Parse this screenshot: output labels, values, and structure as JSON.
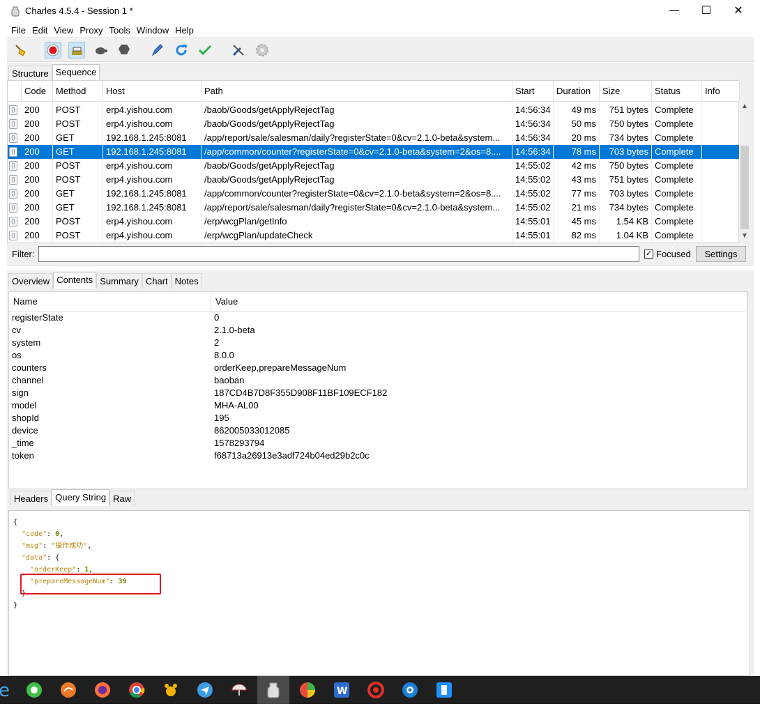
{
  "window": {
    "title": "Charles 4.5.4 - Session 1 *"
  },
  "menu": [
    "File",
    "Edit",
    "View",
    "Proxy",
    "Tools",
    "Window",
    "Help"
  ],
  "toolbar": [
    "broom-icon",
    "record-icon",
    "throttle-icon",
    "turtle-icon",
    "stop-icon",
    "pen-icon",
    "refresh-icon",
    "check-icon",
    "tools-icon",
    "gear-icon"
  ],
  "upper_tabs": [
    "Structure",
    "Sequence"
  ],
  "columns": [
    "Code",
    "Method",
    "Host",
    "Path",
    "Start",
    "Duration",
    "Size",
    "Status",
    "Info"
  ],
  "rows": [
    {
      "code": "200",
      "method": "POST",
      "host": "erp4.yishou.com",
      "path": "/baob/Goods/getApplyRejectTag",
      "start": "14:56:34",
      "duration": "49 ms",
      "size": "751 bytes",
      "status": "Complete",
      "selected": false
    },
    {
      "code": "200",
      "method": "POST",
      "host": "erp4.yishou.com",
      "path": "/baob/Goods/getApplyRejectTag",
      "start": "14:56:34",
      "duration": "50 ms",
      "size": "750 bytes",
      "status": "Complete",
      "selected": false
    },
    {
      "code": "200",
      "method": "GET",
      "host": "192.168.1.245:8081",
      "path": "/app/report/sale/salesman/daily?registerState=0&cv=2.1.0-beta&system...",
      "start": "14:56:34",
      "duration": "20 ms",
      "size": "734 bytes",
      "status": "Complete",
      "selected": false
    },
    {
      "code": "200",
      "method": "GET",
      "host": "192.168.1.245:8081",
      "path": "/app/common/counter?registerState=0&cv=2.1.0-beta&system=2&os=8....",
      "start": "14:56:34",
      "duration": "78 ms",
      "size": "703 bytes",
      "status": "Complete",
      "selected": true
    },
    {
      "code": "200",
      "method": "POST",
      "host": "erp4.yishou.com",
      "path": "/baob/Goods/getApplyRejectTag",
      "start": "14:55:02",
      "duration": "42 ms",
      "size": "750 bytes",
      "status": "Complete",
      "selected": false
    },
    {
      "code": "200",
      "method": "POST",
      "host": "erp4.yishou.com",
      "path": "/baob/Goods/getApplyRejectTag",
      "start": "14:55:02",
      "duration": "43 ms",
      "size": "751 bytes",
      "status": "Complete",
      "selected": false
    },
    {
      "code": "200",
      "method": "GET",
      "host": "192.168.1.245:8081",
      "path": "/app/common/counter?registerState=0&cv=2.1.0-beta&system=2&os=8....",
      "start": "14:55:02",
      "duration": "77 ms",
      "size": "703 bytes",
      "status": "Complete",
      "selected": false
    },
    {
      "code": "200",
      "method": "GET",
      "host": "192.168.1.245:8081",
      "path": "/app/report/sale/salesman/daily?registerState=0&cv=2.1.0-beta&system...",
      "start": "14:55:02",
      "duration": "21 ms",
      "size": "734 bytes",
      "status": "Complete",
      "selected": false
    },
    {
      "code": "200",
      "method": "POST",
      "host": "erp4.yishou.com",
      "path": "/erp/wcgPlan/getInfo",
      "start": "14:55:01",
      "duration": "45 ms",
      "size": "1.54 KB",
      "status": "Complete",
      "selected": false
    },
    {
      "code": "200",
      "method": "POST",
      "host": "erp4.yishou.com",
      "path": "/erp/wcgPlan/updateCheck",
      "start": "14:55:01",
      "duration": "82 ms",
      "size": "1.04 KB",
      "status": "Complete",
      "selected": false
    }
  ],
  "filter": {
    "label": "Filter:",
    "value": "",
    "focused_label": "Focused",
    "focused_checked": true,
    "settings_label": "Settings"
  },
  "detail_tabs": [
    "Overview",
    "Contents",
    "Summary",
    "Chart",
    "Notes"
  ],
  "query": {
    "headers": [
      "Name",
      "Value"
    ],
    "rows": [
      [
        "registerState",
        "0"
      ],
      [
        "cv",
        "2.1.0-beta"
      ],
      [
        "system",
        "2"
      ],
      [
        "os",
        "8.0.0"
      ],
      [
        "counters",
        "orderKeep,prepareMessageNum"
      ],
      [
        "channel",
        "baoban"
      ],
      [
        "sign",
        "187CD4B7D8F355D908F11BF109ECF182"
      ],
      [
        "model",
        "MHA-AL00"
      ],
      [
        "shopId",
        "195"
      ],
      [
        "device",
        "862005033012085"
      ],
      [
        "_time",
        "1578293794"
      ],
      [
        "token",
        "f68713a26913e3adf724b04ed29b2c0c"
      ]
    ]
  },
  "request_tabs": [
    "Headers",
    "Query String",
    "Raw"
  ],
  "response_json": {
    "l1": "{",
    "code_key": "\"code\"",
    "code_val": "0",
    "msg_key": "\"msg\"",
    "msg_val": "\"操作成功\"",
    "data_key": "\"data\"",
    "orderKeep_key": "\"orderKeep\"",
    "orderKeep_val": "1",
    "pmn_key": "\"prepareMessageNum\"",
    "pmn_val": "39",
    "close_inner": "}",
    "close_outer": "}"
  },
  "taskbar": [
    "ie-icon",
    "360-browser-icon",
    "orange-app-icon",
    "firefox-icon",
    "chrome-icon",
    "paw-app-icon",
    "feishu-icon",
    "umbrella-app-icon",
    "charles-icon",
    "color-app-icon",
    "wps-icon",
    "swirl-app-icon",
    "camera-app-icon",
    "phone-app-icon"
  ]
}
